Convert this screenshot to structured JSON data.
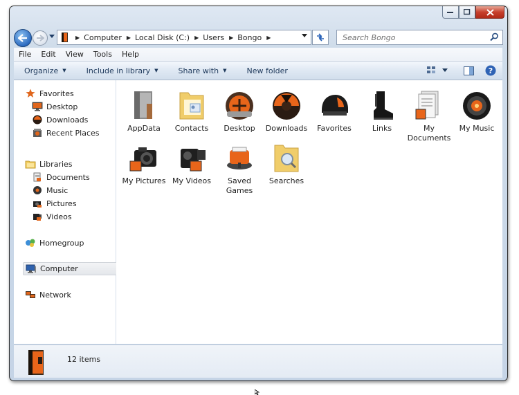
{
  "caption_buttons": {
    "minimize": "minimize",
    "maximize": "maximize",
    "close": "close"
  },
  "breadcrumb": [
    "Computer",
    "Local Disk (C:)",
    "Users",
    "Bongo"
  ],
  "search": {
    "placeholder": "Search Bongo"
  },
  "menu": [
    "File",
    "Edit",
    "View",
    "Tools",
    "Help"
  ],
  "commands": [
    {
      "label": "Organize",
      "dropdown": true
    },
    {
      "label": "Include in library",
      "dropdown": true
    },
    {
      "label": "Share with",
      "dropdown": true
    },
    {
      "label": "New folder",
      "dropdown": false
    }
  ],
  "nav": {
    "favorites": {
      "label": "Favorites",
      "items": [
        "Desktop",
        "Downloads",
        "Recent Places"
      ]
    },
    "libraries": {
      "label": "Libraries",
      "items": [
        "Documents",
        "Music",
        "Pictures",
        "Videos"
      ]
    },
    "homegroup": "Homegroup",
    "computer": "Computer",
    "network": "Network"
  },
  "items": [
    {
      "label": "AppData",
      "icon": "appdata-folder-icon"
    },
    {
      "label": "Contacts",
      "icon": "contacts-folder-icon"
    },
    {
      "label": "Desktop",
      "icon": "desktop-folder-icon"
    },
    {
      "label": "Downloads",
      "icon": "downloads-folder-icon"
    },
    {
      "label": "Favorites",
      "icon": "favorites-folder-icon"
    },
    {
      "label": "Links",
      "icon": "links-folder-icon"
    },
    {
      "label": "My Documents",
      "icon": "documents-folder-icon"
    },
    {
      "label": "My Music",
      "icon": "music-folder-icon"
    },
    {
      "label": "My Pictures",
      "icon": "pictures-folder-icon"
    },
    {
      "label": "My Videos",
      "icon": "videos-folder-icon"
    },
    {
      "label": "Saved Games",
      "icon": "saved-games-folder-icon"
    },
    {
      "label": "Searches",
      "icon": "searches-folder-icon"
    }
  ],
  "status": {
    "count": "12 items"
  },
  "colors": {
    "accent_orange": "#e8651a",
    "link_blue": "#1e395b",
    "selection": "#e4e7eb"
  }
}
